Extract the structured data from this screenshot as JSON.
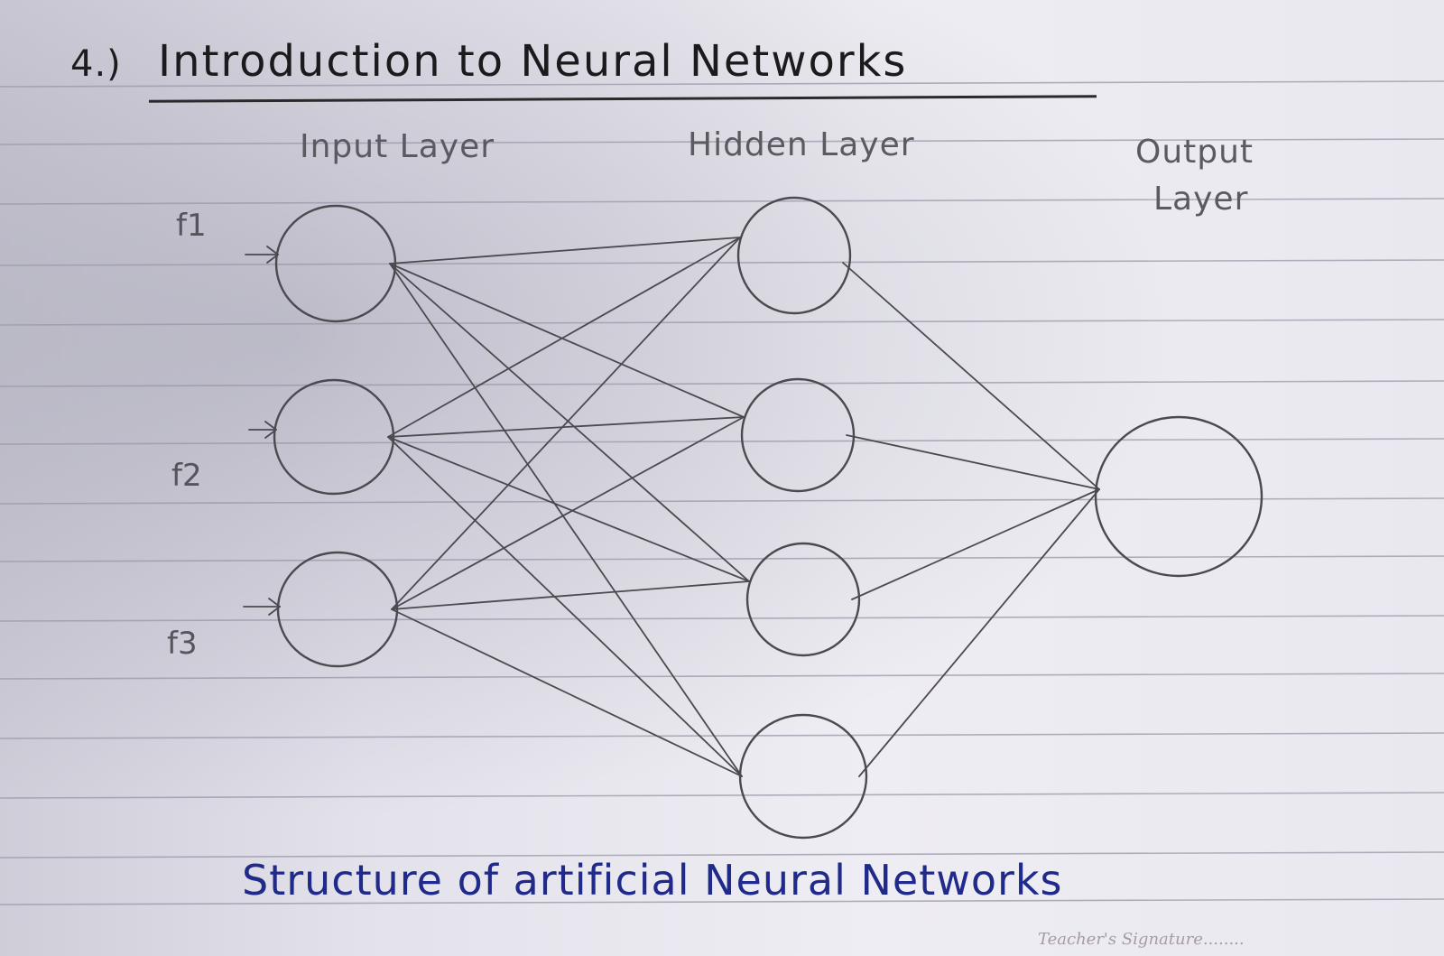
{
  "heading": {
    "number": "4.)",
    "title": "Introduction to Neural Networks"
  },
  "layer_labels": {
    "input": "Input Layer",
    "hidden": "Hidden Layer",
    "output_line1": "Output",
    "output_line2": "Layer"
  },
  "features": [
    "f1",
    "f2",
    "f3"
  ],
  "caption": "Structure of artificial Neural Networks",
  "footer": {
    "teacher_signature": "Teacher's Signature........"
  },
  "colors": {
    "pencil": "#4a4a4f",
    "ink_blue": "#1f2a8a",
    "ruled_line": "#9a98a8",
    "paper": "#e6e4ee"
  }
}
